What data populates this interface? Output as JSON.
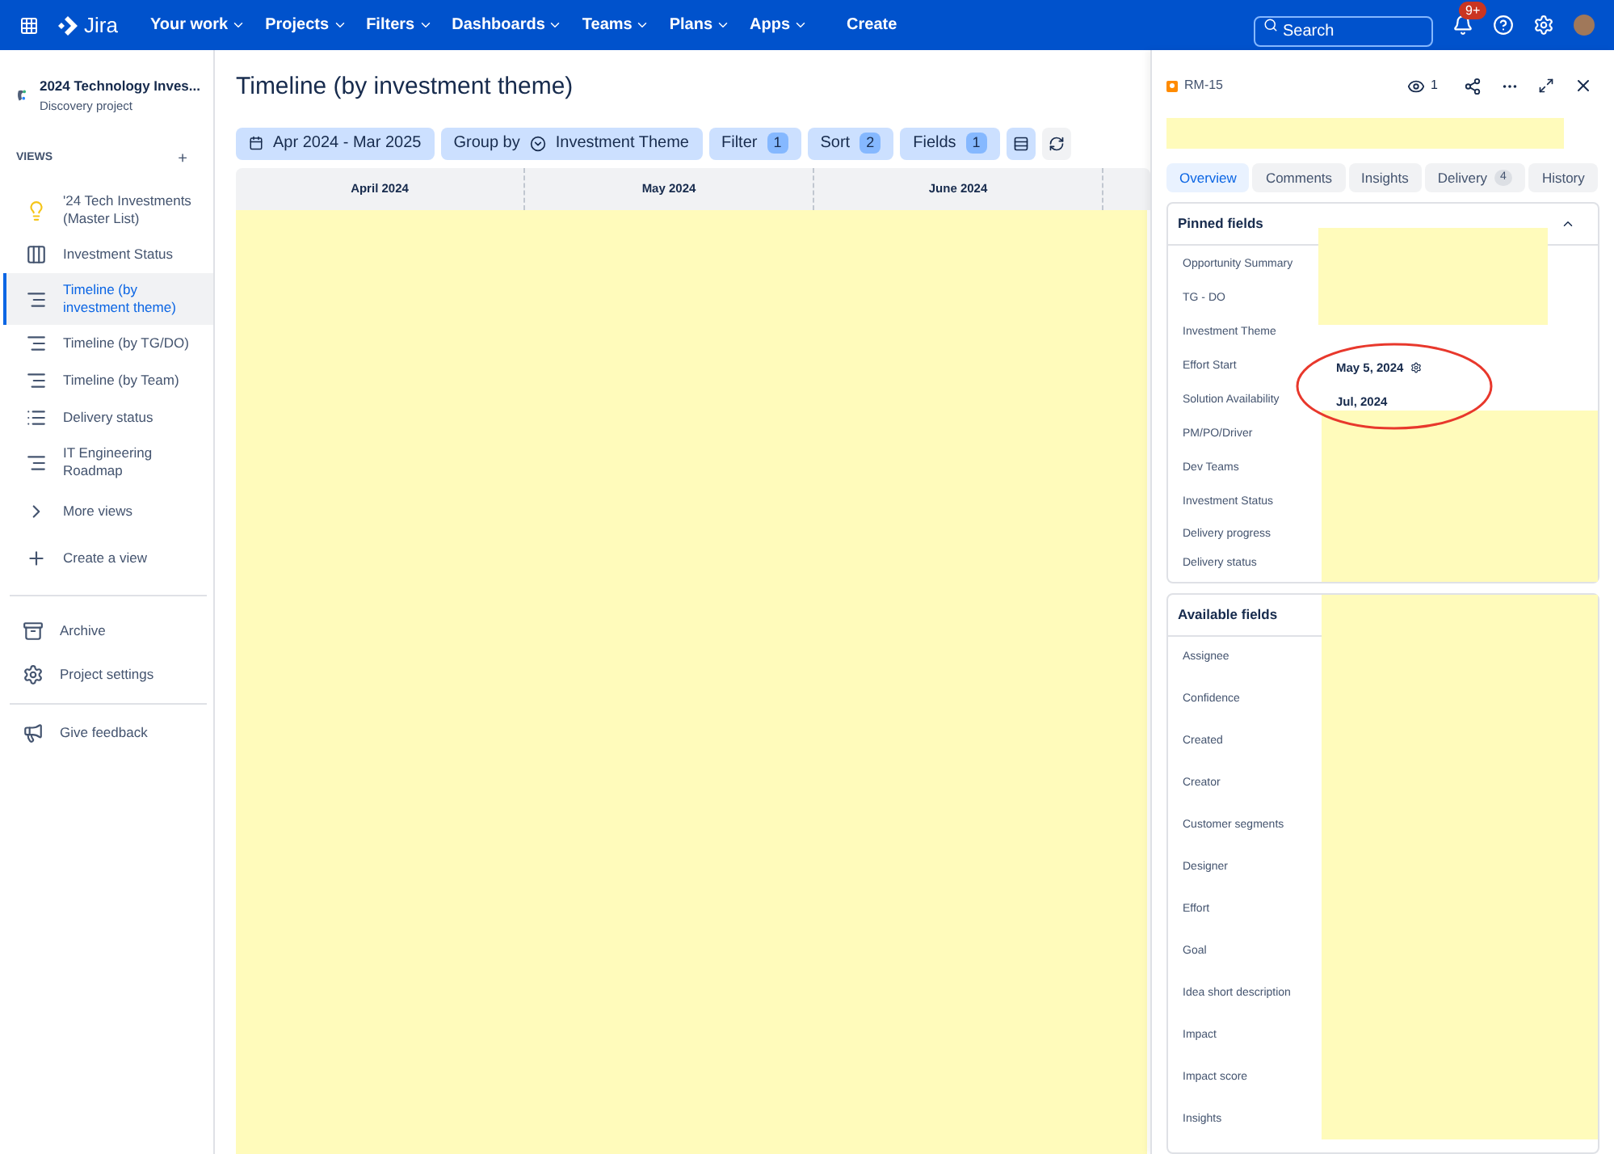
{
  "topbar": {
    "product": "Jira",
    "menus": [
      {
        "label": "Your work",
        "dropdown": true
      },
      {
        "label": "Projects",
        "dropdown": true
      },
      {
        "label": "Filters",
        "dropdown": true
      },
      {
        "label": "Dashboards",
        "dropdown": true
      },
      {
        "label": "Teams",
        "dropdown": true
      },
      {
        "label": "Plans",
        "dropdown": true
      },
      {
        "label": "Apps",
        "dropdown": true
      },
      {
        "label": "Create",
        "dropdown": false
      }
    ],
    "search": {
      "placeholder": "Search"
    },
    "notifications": "9+"
  },
  "sidebar": {
    "project": {
      "name": "2024 Technology Inves...",
      "type": "Discovery project"
    },
    "views_heading": "VIEWS",
    "add": "+",
    "items": [
      {
        "label": "'24 Tech Investments (Master List)",
        "kind": "bulb",
        "selected": false
      },
      {
        "label": "Investment Status",
        "kind": "board",
        "selected": false
      },
      {
        "label": "Timeline (by investment theme)",
        "kind": "timeline",
        "selected": true
      },
      {
        "label": "Timeline (by TG/DO)",
        "kind": "timeline",
        "selected": false
      },
      {
        "label": "Timeline (by Team)",
        "kind": "timeline",
        "selected": false
      },
      {
        "label": "Delivery status",
        "kind": "list",
        "selected": false
      },
      {
        "label": "IT Engineering Roadmap",
        "kind": "timeline",
        "selected": false
      },
      {
        "label": "More views",
        "kind": "chevron",
        "selected": false
      },
      {
        "label": "Create a view",
        "kind": "plus",
        "selected": false
      }
    ],
    "footer": [
      {
        "label": "Archive",
        "kind": "archive"
      },
      {
        "label": "Project settings",
        "kind": "gear"
      },
      {
        "label": "Give feedback",
        "kind": "megaphone"
      }
    ]
  },
  "main": {
    "title": "Timeline (by investment theme)",
    "toolbar": {
      "date_range": "Apr 2024 - Mar 2025",
      "group_by_label": "Group by",
      "group_by_value": "Investment Theme",
      "filter": {
        "label": "Filter",
        "count": "1"
      },
      "sort": {
        "label": "Sort",
        "count": "2"
      },
      "fields": {
        "label": "Fields",
        "count": "1"
      }
    },
    "months": [
      "April 2024",
      "May 2024",
      "June 2024"
    ]
  },
  "panel": {
    "key": "RM-15",
    "watchers": "1",
    "tabs": [
      {
        "label": "Overview",
        "selected": true
      },
      {
        "label": "Comments",
        "selected": false
      },
      {
        "label": "Insights",
        "selected": false
      },
      {
        "label": "Delivery",
        "count": "4",
        "selected": false
      },
      {
        "label": "History",
        "selected": false
      }
    ],
    "pinned": {
      "title": "Pinned fields",
      "expanded": true,
      "fields": [
        {
          "label": "Opportunity Summary"
        },
        {
          "label": "TG - DO"
        },
        {
          "label": "Investment Theme"
        },
        {
          "label": "Effort Start",
          "value": "May 5, 2024"
        },
        {
          "label": "Solution Availability",
          "value": "Jul, 2024"
        },
        {
          "label": "PM/PO/Driver"
        },
        {
          "label": "Dev Teams"
        },
        {
          "label": "Investment Status"
        },
        {
          "label": "Delivery progress"
        },
        {
          "label": "Delivery status"
        }
      ]
    },
    "available": {
      "title": "Available fields",
      "fields": [
        "Assignee",
        "Confidence",
        "Created",
        "Creator",
        "Customer segments",
        "Designer",
        "Effort",
        "Goal",
        "Idea short description",
        "Impact",
        "Impact score",
        "Insights"
      ]
    }
  }
}
